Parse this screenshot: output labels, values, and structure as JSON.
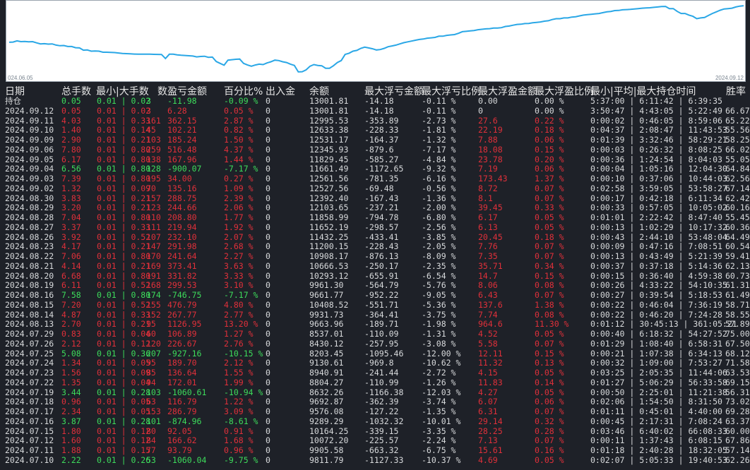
{
  "chart": {
    "x_start": "024.06.05",
    "x_end": "2024.09.12",
    "line_color": "#2aa7e6",
    "curve": [
      40,
      40.5,
      43.5,
      41.5,
      42,
      41,
      41.5,
      38.5,
      36,
      36.5,
      35.5,
      36,
      33,
      31.5,
      32,
      29.5,
      29.5,
      26.5,
      26,
      20.5,
      21,
      18,
      18.5,
      18,
      15.5,
      15.5,
      15,
      14.5,
      13.5,
      12.5,
      12,
      11.5,
      11,
      10.5,
      10.5,
      10.5,
      10.5,
      10.3,
      10.1,
      9.8,
      0,
      10.5,
      10.5,
      9,
      8,
      7.5,
      6.8,
      6,
      4,
      5,
      5.5,
      3,
      3.5,
      -7.5,
      -12,
      -16.5,
      -4,
      -3,
      -2,
      -1.5,
      -12,
      -16,
      -19,
      -16,
      -14,
      -15,
      -11,
      -8,
      -4,
      -5,
      -8,
      -10,
      -14,
      -17,
      -33,
      -32.5,
      -28,
      -19,
      -15,
      -17,
      -18,
      -24,
      -24,
      -18,
      -10,
      -5,
      10,
      13,
      18,
      20,
      25,
      28,
      26,
      24,
      21,
      22,
      25,
      29,
      31,
      33,
      36,
      39,
      41,
      43,
      45,
      47,
      48,
      50,
      51,
      52,
      55,
      55,
      57,
      58,
      59,
      62,
      66,
      67,
      68,
      69,
      71,
      72,
      73,
      73.5,
      75,
      75,
      76,
      79,
      80,
      82,
      84,
      84.5,
      86,
      86.5,
      88,
      89,
      90,
      92,
      93,
      96,
      98,
      98,
      100,
      100,
      102,
      103,
      105,
      107,
      108,
      109,
      110,
      111,
      113,
      115,
      116,
      118,
      118.5,
      120,
      120.5,
      121,
      122,
      123,
      124,
      124.5,
      125,
      126,
      127,
      128,
      128.3,
      123,
      123,
      116,
      111,
      111,
      107,
      104,
      98,
      100,
      101,
      106,
      111,
      115,
      119,
      122,
      123,
      124,
      127,
      129,
      130
    ],
    "scale_min": -35,
    "scale_max": 132
  },
  "headers": [
    "日期",
    "总手数",
    "最小|大手数",
    "数",
    "盈亏金额",
    "百分比%",
    "出入金",
    "余额",
    "最大浮亏金额",
    "最大浮亏比例",
    "最大浮盈金额",
    "最大浮盈比例",
    "最小|平均|最大持仓时间",
    "胜率"
  ],
  "colors": {
    "profit": "#3ddc5b",
    "loss": "#e0303a",
    "neutral": "#d8dadc"
  },
  "rows": [
    [
      "持仓",
      "0.05",
      "0.01 | 0.02",
      "3",
      "-11.98",
      "-0.09 %",
      "0",
      "13001.81",
      "-14.18",
      "-0.11 %",
      "0.00",
      "0.00 %",
      "5:37:00 | 6:11:42 | 6:39:35",
      ""
    ],
    [
      "2024.09.12",
      "0.05",
      "0.01 | 0.02",
      "3",
      "6.28",
      "0.05 %",
      "0",
      "13001.81",
      "-14.18",
      "-0.11 %",
      "0",
      "0.00 %",
      "3:50:47 | 4:43:05 | 5:22:49",
      "66.67"
    ],
    [
      "2024.09.11",
      "4.03",
      "0.01 | 0.33",
      "161",
      "362.15",
      "2.87 %",
      "0",
      "12995.53",
      "-353.89",
      "-2.73 %",
      "27.6",
      "0.22 %",
      "0:00:02 | 0:46:05 | 8:59:06",
      "65.22"
    ],
    [
      "2024.09.10",
      "1.40",
      "0.01 | 0.14",
      "45",
      "102.21",
      "0.82 %",
      "0",
      "12633.38",
      "-228.33",
      "-1.81 %",
      "22.19",
      "0.18 %",
      "0:04:37 | 2:08:47 | 11:43:53",
      "55.56"
    ],
    [
      "2024.09.09",
      "2.90",
      "0.01 | 0.21",
      "103",
      "185.24",
      "1.50 %",
      "0",
      "12531.17",
      "-164.37",
      "-1.32 %",
      "7.88",
      "0.06 %",
      "0:01:39 | 3:32:46 | 58:29:21",
      "58.25"
    ],
    [
      "2024.09.06",
      "7.80",
      "0.01 | 0.80",
      "259",
      "516.48",
      "4.37 %",
      "0",
      "12345.93",
      "-879.6",
      "-7.17 %",
      "18.08",
      "0.15 %",
      "0:00:03 | 0:26:32 | 8:08:25",
      "66.02"
    ],
    [
      "2024.09.05",
      "6.17",
      "0.01 | 0.80",
      "138",
      "167.96",
      "1.44 %",
      "0",
      "11829.45",
      "-585.27",
      "-4.84 %",
      "23.78",
      "0.20 %",
      "0:00:36 | 1:24:54 | 8:04:03",
      "55.05"
    ],
    [
      "2024.09.04",
      "6.56",
      "0.01 | 0.80",
      "128",
      "-900.07",
      "-7.17 %",
      "0",
      "11661.49",
      "-1172.65",
      "-9.32 %",
      "7.19",
      "0.06 %",
      "0:00:04 | 1:05:16 | 12:04:30",
      "64.84"
    ],
    [
      "2024.09.03",
      "7.39",
      "0.01 | 0.80",
      "195",
      "34.00",
      "0.27 %",
      "0",
      "12561.56",
      "-781.35",
      "-6.16 %",
      "173.43",
      "1.37 %",
      "0:00:10 | 0:37:06 | 10:44:03",
      "62.56"
    ],
    [
      "2024.09.02",
      "1.32",
      "0.01 | 0.09",
      "70",
      "135.16",
      "1.09 %",
      "0",
      "12527.56",
      "-69.48",
      "-0.56 %",
      "8.72",
      "0.07 %",
      "0:02:58 | 3:59:05 | 53:58:27",
      "67.14"
    ],
    [
      "2024.08.30",
      "3.83",
      "0.01 | 0.21",
      "157",
      "288.75",
      "2.39 %",
      "0",
      "12392.40",
      "-167.43",
      "-1.36 %",
      "8.1",
      "0.07 %",
      "0:00:17 | 0:42:18 | 6:11:34",
      "62.42"
    ],
    [
      "2024.08.29",
      "3.20",
      "0.01 | 0.21",
      "123",
      "244.66",
      "2.06 %",
      "0",
      "12103.65",
      "-237.21",
      "-2.00 %",
      "39.45",
      "0.33 %",
      "0:00:33 | 0:57:05 | 10:05:02",
      "60.16"
    ],
    [
      "2024.08.28",
      "7.04",
      "0.01 | 0.80",
      "110",
      "208.80",
      "1.77 %",
      "0",
      "11858.99",
      "-794.78",
      "-6.80 %",
      "6.17",
      "0.05 %",
      "0:01:01 | 2:22:42 | 8:47:40",
      "55.45"
    ],
    [
      "2024.08.27",
      "3.37",
      "0.01 | 0.33",
      "111",
      "219.94",
      "1.92 %",
      "0",
      "11652.19",
      "-298.57",
      "-2.56 %",
      "6.13",
      "0.05 %",
      "0:00:13 | 1:02:29 | 10:17:32",
      "60.36"
    ],
    [
      "2024.08.26",
      "3.92",
      "0.01 | 0.52",
      "107",
      "232.10",
      "2.07 %",
      "0",
      "11432.25",
      "-433.41",
      "-3.85 %",
      "20.45",
      "0.18 %",
      "0:00:43 | 2:44:10 | 53:48:04",
      "64.49"
    ],
    [
      "2024.08.23",
      "4.17",
      "0.01 | 0.21",
      "147",
      "291.98",
      "2.68 %",
      "0",
      "11200.15",
      "-228.43",
      "-2.05 %",
      "7.76",
      "0.07 %",
      "0:00:09 | 0:47:16 | 7:08:51",
      "60.54"
    ],
    [
      "2024.08.22",
      "7.06",
      "0.01 | 0.80",
      "170",
      "241.64",
      "2.27 %",
      "0",
      "10908.17",
      "-876.13",
      "-8.09 %",
      "7.35",
      "0.07 %",
      "0:00:13 | 0:43:49 | 5:21:39",
      "59.41"
    ],
    [
      "2024.08.21",
      "4.14",
      "0.01 | 0.21",
      "169",
      "373.41",
      "3.63 %",
      "0",
      "10666.53",
      "-250.17",
      "-2.35 %",
      "35.71",
      "0.34 %",
      "0:00:37 | 0:37:18 | 5:14:36",
      "62.13"
    ],
    [
      "2024.08.20",
      "6.68",
      "0.01 | 0.80",
      "191",
      "331.82",
      "3.33 %",
      "0",
      "10293.12",
      "-655.91",
      "-6.54 %",
      "14.7",
      "0.15 %",
      "0:00:15 | 0:36:40 | 4:59:38",
      "60.73"
    ],
    [
      "2024.08.19",
      "6.11",
      "0.01 | 0.52",
      "168",
      "299.53",
      "3.10 %",
      "0",
      "9961.30",
      "-564.79",
      "-5.76 %",
      "8.06",
      "0.08 %",
      "0:00:26 | 4:33:22 | 54:10:35",
      "61.31"
    ],
    [
      "2024.08.16",
      "7.58",
      "0.01 | 0.80",
      "174",
      "-746.75",
      "-7.17 %",
      "0",
      "9661.77",
      "-952.22",
      "-9.05 %",
      "6.43",
      "0.07 %",
      "0:00:27 | 0:39:54 | 5:18:53",
      "61.49"
    ],
    [
      "2024.08.15",
      "7.20",
      "0.01 | 0.52",
      "155",
      "476.79",
      "4.80 %",
      "0",
      "10408.52",
      "-551.71",
      "-5.36 %",
      "137.6",
      "1.38 %",
      "0:00:22 | 0:46:04 | 7:36:19",
      "58.71"
    ],
    [
      "2024.08.14",
      "4.87",
      "0.01 | 0.33",
      "152",
      "267.77",
      "2.77 %",
      "0",
      "9931.73",
      "-364.41",
      "-3.75 %",
      "7.74",
      "0.08 %",
      "0:00:22 | 0:46:20 | 7:24:28",
      "58.55"
    ],
    [
      "2024.08.13",
      "2.70",
      "0.01 | 0.21",
      "95",
      "1126.95",
      "13.20 %",
      "0",
      "9663.96",
      "-189.71",
      "-1.98 %",
      "964.6",
      "11.30 %",
      "0:01:12 | 30:45:13 | 361:05:21",
      "57.89"
    ],
    [
      "2024.07.29",
      "0.83",
      "0.01 | 0.04",
      "60",
      "106.89",
      "1.27 %",
      "0",
      "8537.01",
      "-110.09",
      "-1.31 %",
      "4.52",
      "0.05 %",
      "0:00:40 | 6:18:32 | 54:27:52",
      "75.00"
    ],
    [
      "2024.07.26",
      "2.12",
      "0.01 | 0.12",
      "120",
      "226.67",
      "2.76 %",
      "0",
      "8430.12",
      "-257.95",
      "-3.08 %",
      "5.58",
      "0.07 %",
      "0:01:29 | 1:08:40 | 6:58:31",
      "67.50"
    ],
    [
      "2024.07.25",
      "5.08",
      "0.01 | 0.36",
      "207",
      "-927.16",
      "-10.15 %",
      "0",
      "8203.45",
      "-1095.46",
      "-12.00 %",
      "12.11",
      "0.15 %",
      "0:00:21 | 1:07:38 | 6:34:13",
      "68.12"
    ],
    [
      "2024.07.24",
      "1.34",
      "0.01 | 0.05",
      "95",
      "189.70",
      "2.12 %",
      "0",
      "9130.61",
      "-969.8",
      "-10.62 %",
      "11.32",
      "0.13 %",
      "0:00:32 | 1:09:00 | 7:53:27",
      "71.58"
    ],
    [
      "2024.07.23",
      "1.56",
      "0.01 | 0.09",
      "85",
      "136.64",
      "1.55 %",
      "0",
      "8940.91",
      "-241.44",
      "-2.72 %",
      "4.15",
      "0.05 %",
      "0:03:25 | 2:05:35 | 11:44:06",
      "63.53"
    ],
    [
      "2024.07.22",
      "1.35",
      "0.01 | 0.04",
      "94",
      "172.01",
      "1.99 %",
      "0",
      "8804.27",
      "-110.99",
      "-1.26 %",
      "11.83",
      "0.14 %",
      "0:01:27 | 5:06:29 | 56:33:58",
      "69.15"
    ],
    [
      "2024.07.19",
      "3.44",
      "0.01 | 0.28",
      "103",
      "-1060.61",
      "-10.94 %",
      "0",
      "8632.26",
      "-1166.38",
      "-12.03 %",
      "4.27",
      "0.05 %",
      "0:00:50 | 2:25:01 | 11:21:38",
      "56.31"
    ],
    [
      "2024.07.18",
      "0.96",
      "0.01 | 0.05",
      "63",
      "116.79",
      "1.22 %",
      "0",
      "9692.87",
      "-362.39",
      "-3.74 %",
      "6.07",
      "0.06 %",
      "0:02:06 | 1:54:50 | 8:31:50",
      "73.02"
    ],
    [
      "2024.07.17",
      "2.34",
      "0.01 | 0.05",
      "153",
      "286.79",
      "3.09 %",
      "0",
      "9576.08",
      "-127.22",
      "-1.35 %",
      "6.31",
      "0.07 %",
      "0:01:11 | 0:45:01 | 4:40:00",
      "69.28"
    ],
    [
      "2024.07.16",
      "3.87",
      "0.01 | 0.28",
      "101",
      "-874.96",
      "-8.61 %",
      "0",
      "9289.29",
      "-1032.32",
      "-10.01 %",
      "29.14",
      "0.32 %",
      "0:00:45 | 2:17:31 | 7:08:24",
      "63.37"
    ],
    [
      "2024.07.15",
      "1.80",
      "0.01 | 0.12",
      "80",
      "92.05",
      "0.91 %",
      "0",
      "10164.25",
      "-339.15",
      "-3.35 %",
      "28.25",
      "0.28 %",
      "0:03:46 | 6:40:02 | 66:08:33",
      "60.00"
    ],
    [
      "2024.07.12",
      "1.60",
      "0.01 | 0.12",
      "84",
      "166.62",
      "1.68 %",
      "0",
      "10072.20",
      "-225.57",
      "-2.24 %",
      "7.13",
      "0.07 %",
      "0:00:11 | 1:37:43 | 6:08:15",
      "67.86"
    ],
    [
      "2024.07.11",
      "1.88",
      "0.01 | 0.15",
      "77",
      "93.79",
      "0.96 %",
      "0",
      "9905.58",
      "-663.32",
      "-6.75 %",
      "15.61",
      "0.16 %",
      "0:01:18 | 2:40:28 | 18:32:05",
      "57.14"
    ],
    [
      "2024.07.10",
      "2.22",
      "0.01 | 0.26",
      "53",
      "-1060.04",
      "-9.75 %",
      "0",
      "9811.79",
      "-1127.33",
      "-10.37 %",
      "4.69",
      "0.05 %",
      "0:02:07 | 5:05:33 | 19:40:53",
      "62.26"
    ]
  ]
}
